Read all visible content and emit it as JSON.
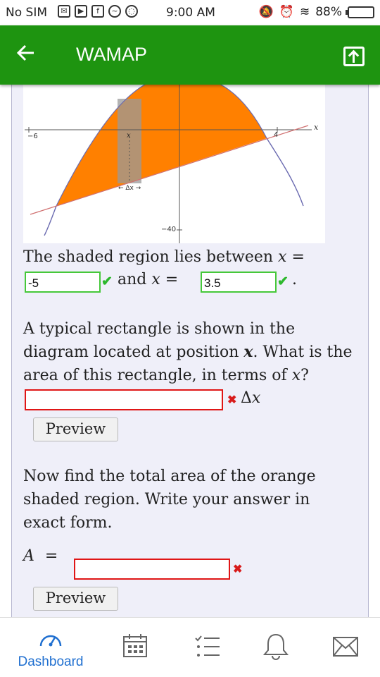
{
  "status_bar": {
    "carrier": "No SIM",
    "time": "9:00 AM",
    "battery": "88%",
    "battery_level": 0.88
  },
  "app_bar": {
    "title": "WAMAP",
    "back_icon": "arrow-left-icon",
    "share_icon": "open-external-icon"
  },
  "graph": {
    "tick_left": "−6",
    "tick_right": "4",
    "axis_x_label": "x",
    "rect_label": "x",
    "width_label": "← Δx →",
    "tick_bottom": "−40"
  },
  "question1": {
    "text_before": "The shaded region lies between",
    "var": "x",
    "eq": "=",
    "and": "and",
    "answer_left": "-5",
    "answer_right": "3.5",
    "period": "."
  },
  "question2": {
    "line1": "A typical rectangle is shown in the",
    "line2_a": "diagram located at position",
    "line2_b": "x",
    "line2_c": ". What is the",
    "line3_a": "area of this rectangle, in terms of",
    "line3_b": "x",
    "line3_c": "?",
    "answer": "",
    "suffix": "Δ",
    "suffix_var": "x",
    "preview": "Preview"
  },
  "question3": {
    "line1": "Now find the total area of the orange",
    "line2": "shaded region. Write your answer in",
    "line3": "exact form.",
    "var": "A",
    "eq": "=",
    "answer": "",
    "preview": "Preview"
  },
  "bottom_nav": {
    "dashboard": "Dashboard"
  },
  "colors": {
    "app_bar": "#1e9410",
    "shade": "#ff8000",
    "correct": "#46c83a",
    "wrong": "#e01616",
    "nav_active": "#1f6fd0"
  }
}
